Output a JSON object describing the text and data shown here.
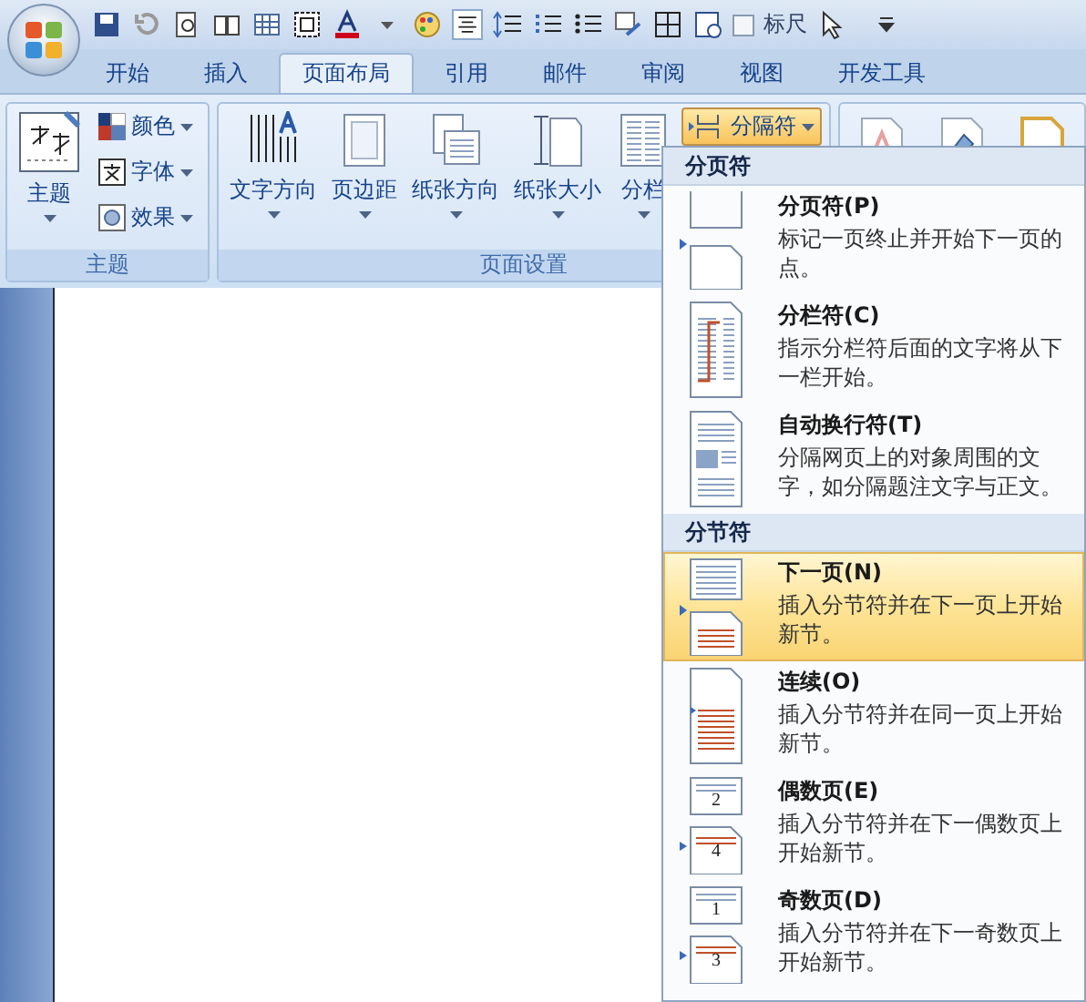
{
  "quick_access": {
    "ruler": {
      "label": "标尺",
      "checked": false
    }
  },
  "tabs": [
    {
      "label": "开始",
      "selected": false
    },
    {
      "label": "插入",
      "selected": false
    },
    {
      "label": "页面布局",
      "selected": true
    },
    {
      "label": "引用",
      "selected": false
    },
    {
      "label": "邮件",
      "selected": false
    },
    {
      "label": "审阅",
      "selected": false
    },
    {
      "label": "视图",
      "selected": false
    },
    {
      "label": "开发工具",
      "selected": false
    }
  ],
  "ribbon": {
    "groups": [
      {
        "label": "主题",
        "big": [
          {
            "label": "主题",
            "kind": "theme"
          }
        ],
        "small": [
          {
            "label": "颜色",
            "kind": "colors"
          },
          {
            "label": "字体",
            "kind": "fonts"
          },
          {
            "label": "效果",
            "kind": "effects"
          }
        ]
      },
      {
        "label": "页面设置",
        "big": [
          {
            "label": "文字方向",
            "kind": "text-direction"
          },
          {
            "label": "页边距",
            "kind": "margins"
          },
          {
            "label": "纸张方向",
            "kind": "orientation"
          },
          {
            "label": "纸张大小",
            "kind": "size"
          },
          {
            "label": "分栏",
            "kind": "columns"
          }
        ],
        "small": [
          {
            "label": "分隔符",
            "kind": "breaks",
            "active": true
          }
        ]
      }
    ]
  },
  "menu": {
    "sections": [
      {
        "header": "分页符",
        "items": [
          {
            "kind": "page-break",
            "title": "分页符(P)",
            "description": "标记一页终止并开始下一页的点。",
            "selected": false
          },
          {
            "kind": "column-break",
            "title": "分栏符(C)",
            "description": "指示分栏符后面的文字将从下一栏开始。",
            "selected": false
          },
          {
            "kind": "text-wrap",
            "title": "自动换行符(T)",
            "description": "分隔网页上的对象周围的文字，如分隔题注文字与正文。",
            "selected": false
          }
        ]
      },
      {
        "header": "分节符",
        "items": [
          {
            "kind": "next-page",
            "title": "下一页(N)",
            "description": "插入分节符并在下一页上开始新节。",
            "selected": true
          },
          {
            "kind": "continuous",
            "title": "连续(O)",
            "description": "插入分节符并在同一页上开始新节。",
            "selected": false
          },
          {
            "kind": "even-page",
            "title": "偶数页(E)",
            "description": "插入分节符并在下一偶数页上开始新节。",
            "page_numbers": [
              "2",
              "4"
            ],
            "selected": false
          },
          {
            "kind": "odd-page",
            "title": "奇数页(D)",
            "description": "插入分节符并在下一奇数页上开始新节。",
            "page_numbers": [
              "1",
              "3"
            ],
            "selected": false
          }
        ]
      }
    ]
  }
}
